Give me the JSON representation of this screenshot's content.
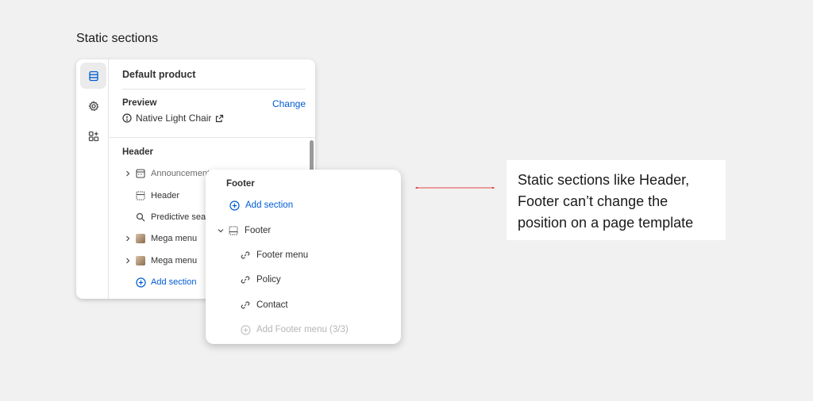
{
  "page": {
    "heading": "Static sections"
  },
  "rail": {
    "items": [
      {
        "name": "sections",
        "icon": "sections-icon",
        "active": true
      },
      {
        "name": "settings",
        "icon": "gear-icon",
        "active": false
      },
      {
        "name": "apps",
        "icon": "apps-add-icon",
        "active": false
      }
    ]
  },
  "panel": {
    "template_title": "Default product",
    "preview": {
      "label": "Preview",
      "change_label": "Change",
      "product": "Native Light Chair"
    },
    "group_label": "Header",
    "rows": [
      {
        "label": "Announcement",
        "icon": "announcement-bar-icon",
        "has_chevron": true
      },
      {
        "label": "Header",
        "icon": "header-layout-icon",
        "has_chevron": false
      },
      {
        "label": "Predictive sea",
        "icon": "search-icon",
        "has_chevron": false
      },
      {
        "label": "Mega menu",
        "icon": "image-thumbnail",
        "has_chevron": true
      },
      {
        "label": "Mega menu",
        "icon": "image-thumbnail",
        "has_chevron": true
      }
    ],
    "add_section_label": "Add section"
  },
  "footer_card": {
    "title": "Footer",
    "add_section_label": "Add section",
    "section_label": "Footer",
    "blocks": [
      "Footer menu",
      "Policy",
      "Contact"
    ],
    "add_block_label": "Add Footer menu (3/3)"
  },
  "callout": {
    "text": "Static sections like Header, Footer can’t change the position on a page template"
  },
  "colors": {
    "accent": "#005bd3",
    "connector": "#e5484d",
    "background": "#f1f1f1"
  }
}
